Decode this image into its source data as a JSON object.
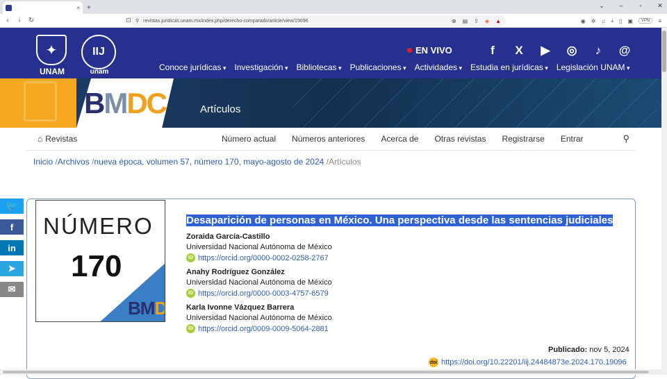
{
  "browser": {
    "tab_title": "Desaparición de personas en M",
    "tab_close": "×",
    "new_tab": "+",
    "url": "revistas.juridicas.unam.mx/index.php/derecho-comparado/article/view/19096",
    "vpn": "VPN"
  },
  "header": {
    "unam_label": "UNAM",
    "iij_label": "unam",
    "en_vivo": "EN VIVO",
    "social": [
      "f",
      "X",
      "▶",
      "◎",
      "♪",
      "@"
    ],
    "nav": [
      "Conoce jurídicas",
      "Investigación",
      "Bibliotecas",
      "Publicaciones",
      "Actividades",
      "Estudia en jurídicas",
      "Legislación UNAM"
    ]
  },
  "banner": {
    "logo_b": "B",
    "logo_m": "M",
    "logo_dc": "DC",
    "section": "Artículos"
  },
  "journal_nav": {
    "home": "Revistas",
    "items": [
      "Número actual",
      "Números anteriores",
      "Acerca de",
      "Otras revistas",
      "Registrarse",
      "Entrar"
    ]
  },
  "breadcrumb": {
    "inicio": "Inicio",
    "archivos": "Archivos",
    "issue": "nueva época, volumen 57, número 170, mayo-agosto de 2024",
    "current": "Artículos"
  },
  "cover": {
    "numero": "NÚMERO",
    "number": "170",
    "logo_b": "BM",
    "logo_dc": "DC"
  },
  "article": {
    "title": "Desaparición de personas en México. Una perspectiva desde las sentencias judiciales",
    "authors": [
      {
        "name": "Zoraida García-Castillo",
        "affiliation": "Universidad Nacional Autónoma de México",
        "orcid": "https://orcid.org/0000-0002-0258-2767"
      },
      {
        "name": "Anahy Rodríguez González",
        "affiliation": "Universidad Nacional Autónoma de México",
        "orcid": "https://orcid.org/0000-0003-4757-6579"
      },
      {
        "name": "Karla Ivonne Vázquez Barrera",
        "affiliation": "Universidad Nacional Autónoma de México",
        "orcid": "https://orcid.org/0009-0009-5064-2881"
      }
    ],
    "published_label": "Publicado:",
    "published_date": "nov 5, 2024",
    "doi": "https://doi.org/10.22201/iij.24484873e.2024.170.19096"
  }
}
